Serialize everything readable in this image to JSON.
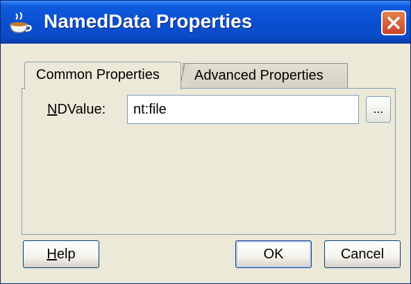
{
  "window": {
    "title": "NamedData Properties",
    "title_icon": "cup-icon",
    "close_icon": "close-icon"
  },
  "tabs": [
    {
      "label": "Common Properties",
      "selected": true
    },
    {
      "label": "Advanced Properties",
      "selected": false
    }
  ],
  "form": {
    "field_label_mnemonic": "N",
    "field_label_rest": "DValue:",
    "field_value": "nt:file",
    "browse_label": "..."
  },
  "buttons": {
    "help_mnemonic": "H",
    "help_rest": "elp",
    "ok": "OK",
    "cancel": "Cancel"
  },
  "colors": {
    "titlebar": "#0a4fd0",
    "close_button": "#c8442b",
    "dialog_background": "#ece9d8"
  }
}
